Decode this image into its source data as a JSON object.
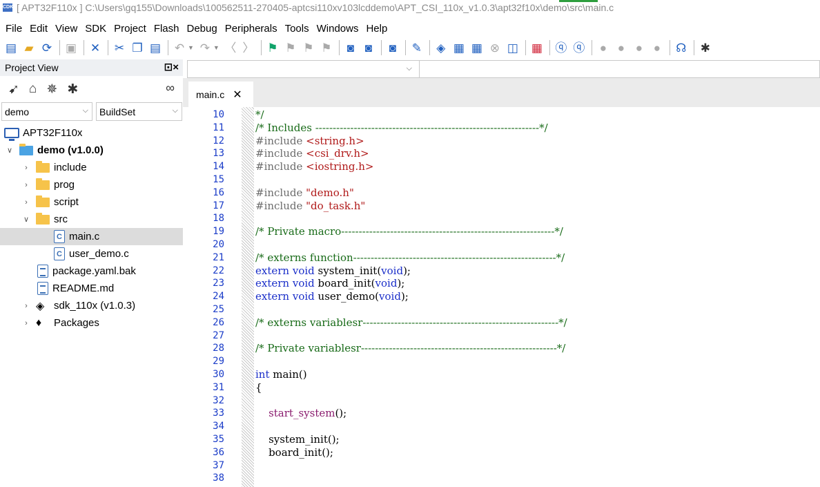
{
  "window": {
    "title": "[ APT32F110x ] C:\\Users\\gq155\\Downloads\\100562511-270405-aptcsi110xv103lcddemo\\APT_CSI_110x_v1.0.3\\apt32f10x\\demo\\src\\main.c",
    "app_icon_label": "CDK"
  },
  "menu": [
    "File",
    "Edit",
    "View",
    "SDK",
    "Project",
    "Flash",
    "Debug",
    "Peripherals",
    "Tools",
    "Windows",
    "Help"
  ],
  "project_view": {
    "title": "Project View",
    "project_combo": "demo",
    "buildset_combo": "BuildSet",
    "tree": [
      {
        "label": "APT32F110x",
        "icon": "monitor-icon"
      },
      {
        "label": "demo (v1.0.0)",
        "icon": "folder-icon",
        "bold": true,
        "expanded": true
      },
      {
        "label": "include",
        "icon": "folder-icon"
      },
      {
        "label": "prog",
        "icon": "folder-icon"
      },
      {
        "label": "script",
        "icon": "folder-icon"
      },
      {
        "label": "src",
        "icon": "folder-icon",
        "expanded": true
      },
      {
        "label": "main.c",
        "icon": "c-file-icon",
        "selected": true
      },
      {
        "label": "user_demo.c",
        "icon": "c-file-icon"
      },
      {
        "label": "package.yaml.bak",
        "icon": "document-icon"
      },
      {
        "label": "README.md",
        "icon": "document-icon"
      },
      {
        "label": "sdk_110x (v1.0.3)",
        "icon": "sdk-diamond-icon"
      },
      {
        "label": "Packages",
        "icon": "packages-gem-icon"
      }
    ]
  },
  "editor": {
    "tab_label": "main.c",
    "tab_close": "✕",
    "line_numbers": [
      "10",
      "11",
      "12",
      "13",
      "14",
      "15",
      "16",
      "17",
      "18",
      "19",
      "20",
      "21",
      "22",
      "23",
      "24",
      "25",
      "26",
      "27",
      "28",
      "29",
      "30",
      "31",
      "32",
      "33",
      "34",
      "35",
      "36",
      "37",
      "38"
    ],
    "lines": [
      "*/",
      "/* Includes ----------------------------------------------------------------*/",
      "#include <string.h>",
      "#include <csi_drv.h>",
      "#include <iostring.h>",
      "",
      "#include \"demo.h\"",
      "#include \"do_task.h\"",
      "",
      "/* Private macro-------------------------------------------------------------*/",
      "",
      "/* externs function----------------------------------------------------------*/",
      "extern void system_init(void);",
      "extern void board_init(void);",
      "extern void user_demo(void);",
      "",
      "/* externs variablesr--------------------------------------------------------*/",
      "",
      "/* Private variablesr--------------------------------------------------------*/",
      "",
      "int main()",
      "{",
      "",
      "    start_system();",
      "",
      "    system_init();",
      "    board_init();",
      "",
      ""
    ]
  },
  "colors": {
    "comment": "#176a17",
    "preprocessor": "#6c6c6c",
    "string": "#b01919",
    "keyword": "#1a2ec9",
    "function_call": "#8a1c6e",
    "line_number": "#1a3cc8"
  }
}
